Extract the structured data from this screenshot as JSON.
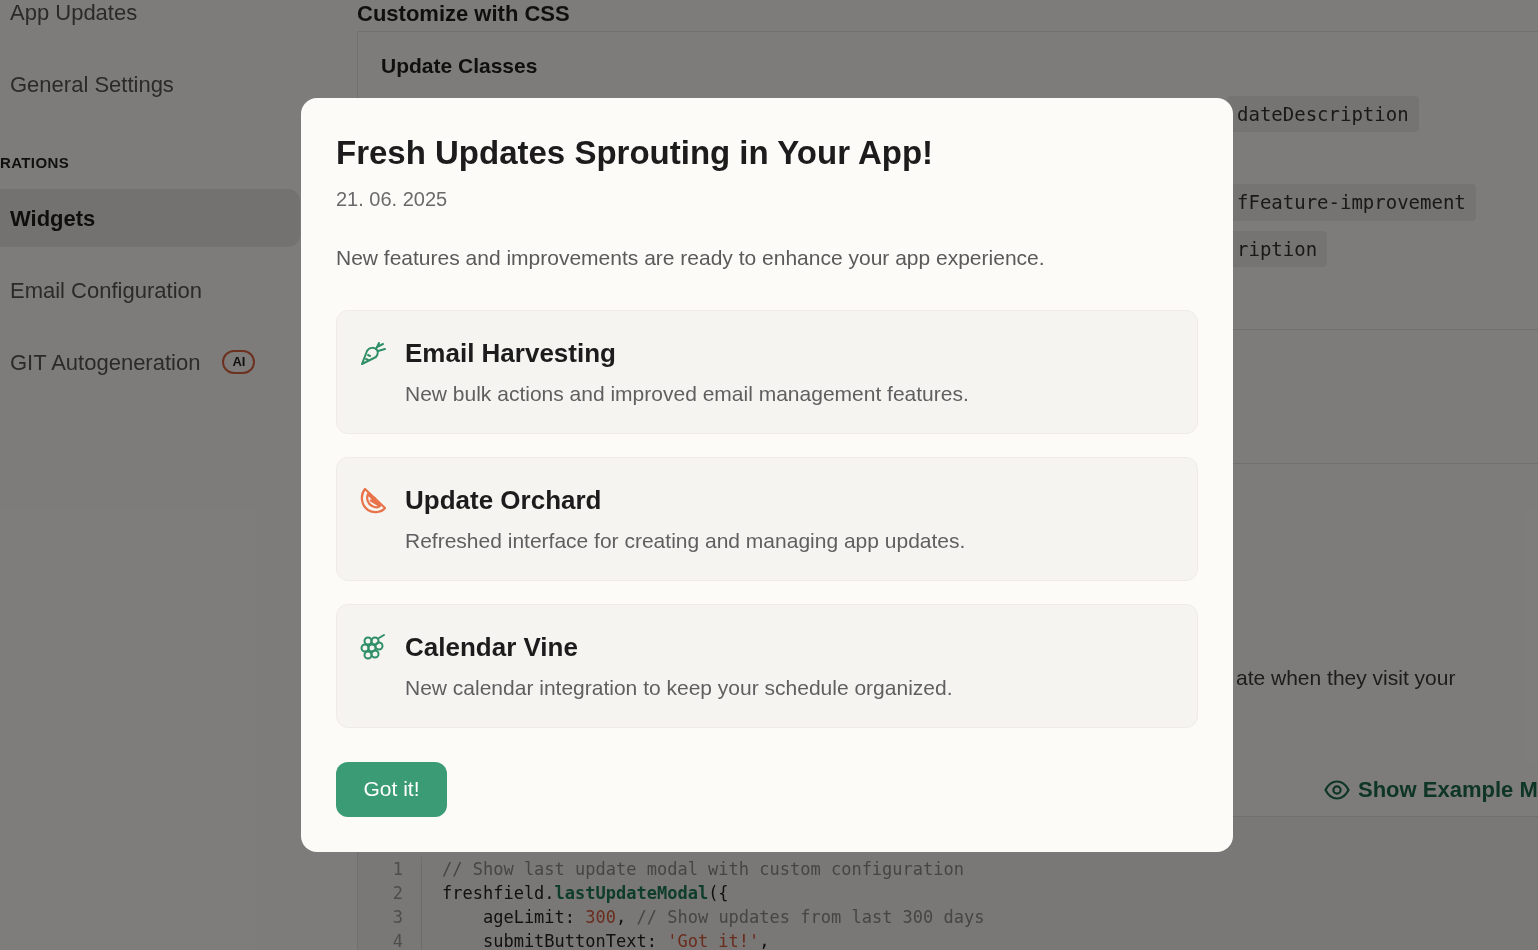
{
  "sidebar": {
    "items": [
      {
        "kind": "item",
        "label": "App Updates",
        "selected": false
      },
      {
        "kind": "item",
        "label": "General Settings",
        "selected": false
      },
      {
        "kind": "heading",
        "label": "RATIONS"
      },
      {
        "kind": "item",
        "label": "Widgets",
        "selected": true
      },
      {
        "kind": "item",
        "label": "Email Configuration",
        "selected": false
      },
      {
        "kind": "item",
        "label": "GIT Autogeneration",
        "selected": false,
        "badge": "AI"
      }
    ]
  },
  "main": {
    "heading": "Customize with CSS",
    "update_classes": {
      "title": "Update Classes",
      "chips": [
        [
          "dateDescription"
        ],
        [
          "fFeature-improvement"
        ],
        [
          "ription"
        ]
      ]
    },
    "text": "ate when they visit your",
    "example_link": "Show Example M",
    "code": [
      {
        "number": "1",
        "tokens": [
          {
            "kind": "comment",
            "text": "// Show last update modal with custom configuration"
          }
        ]
      },
      {
        "number": "2",
        "tokens": [
          {
            "kind": "plain",
            "text": "freshfield."
          },
          {
            "kind": "function",
            "text": "lastUpdateModal"
          },
          {
            "kind": "plain",
            "text": "({"
          }
        ]
      },
      {
        "number": "3",
        "tokens": [
          {
            "kind": "plain",
            "text": "    ageLimit: "
          },
          {
            "kind": "number",
            "text": "300"
          },
          {
            "kind": "plain",
            "text": ", "
          },
          {
            "kind": "comment",
            "text": "// Show updates from last 300 days"
          }
        ]
      },
      {
        "number": "4",
        "tokens": [
          {
            "kind": "plain",
            "text": "    submitButtonText: "
          },
          {
            "kind": "string",
            "text": "'Got it!'"
          },
          {
            "kind": "plain",
            "text": ","
          }
        ]
      }
    ]
  },
  "modal": {
    "title": "Fresh Updates Sprouting in Your App!",
    "date": "21. 06. 2025",
    "description": "New features and improvements are ready to enhance your app experience.",
    "features": [
      {
        "title": "Email Harvesting",
        "description": "New bulk actions and improved email management features.",
        "color": "#2f8f66"
      },
      {
        "title": "Update Orchard",
        "description": "Refreshed interface for creating and managing app updates.",
        "color": "#e8734a"
      },
      {
        "title": "Calendar Vine",
        "description": "New calendar integration to keep your schedule organized.",
        "color": "#2f8f66"
      }
    ],
    "button": "Got it!"
  }
}
